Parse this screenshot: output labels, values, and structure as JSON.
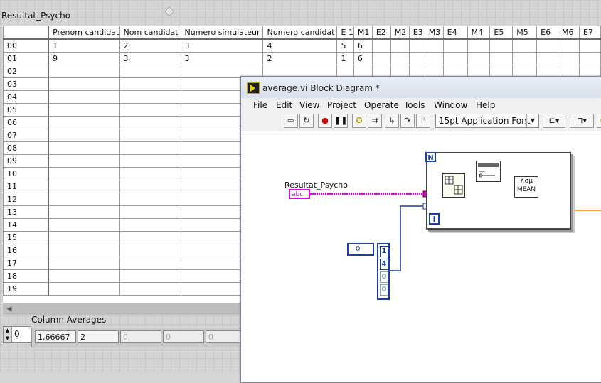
{
  "front_panel": {
    "table_label": "Resultat_Psycho",
    "columns": [
      "Prenom candidat",
      "Nom candidat",
      "Numero simulateur",
      "Numero candidat",
      "E 1",
      "M1",
      "E2",
      "M2",
      "E3",
      "M3",
      "E4",
      "M4",
      "E5",
      "M5",
      "E6",
      "M6",
      "E7"
    ],
    "row_headers": [
      "00",
      "01",
      "02",
      "03",
      "04",
      "05",
      "06",
      "07",
      "08",
      "09",
      "10",
      "11",
      "12",
      "13",
      "14",
      "15",
      "16",
      "17",
      "18",
      "19"
    ],
    "rows": [
      [
        "1",
        "2",
        "3",
        "4",
        "5",
        "6",
        "",
        "",
        "",
        "",
        "",
        "",
        "",
        "",
        "",
        "",
        ""
      ],
      [
        "9",
        "3",
        "3",
        "2",
        "1",
        "6",
        "",
        "",
        "",
        "",
        "",
        "",
        "",
        "",
        "",
        "",
        ""
      ]
    ],
    "column_averages_label": "Column Averages",
    "column_averages_index": "0",
    "column_averages": [
      "1,66667",
      "2",
      "0",
      "0",
      "0"
    ]
  },
  "block_diagram": {
    "title": "average.vi Block Diagram *",
    "menu": [
      "File",
      "Edit",
      "View",
      "Project",
      "Operate",
      "Tools",
      "Window",
      "Help"
    ],
    "font_select": "15pt Application Font",
    "string_constant_label": "Resultat_Psycho",
    "string_constant_text": "abc",
    "loop_count_terminal": "N",
    "loop_iteration_terminal": "i",
    "mean_label": "MEAN",
    "index_value": "0",
    "array_values": [
      "1",
      "4",
      "0",
      "0"
    ]
  },
  "colors": {
    "string_wire": "#d60ad6",
    "int_wire": "#1a3fa0",
    "float_wire": "#ff7f00"
  }
}
